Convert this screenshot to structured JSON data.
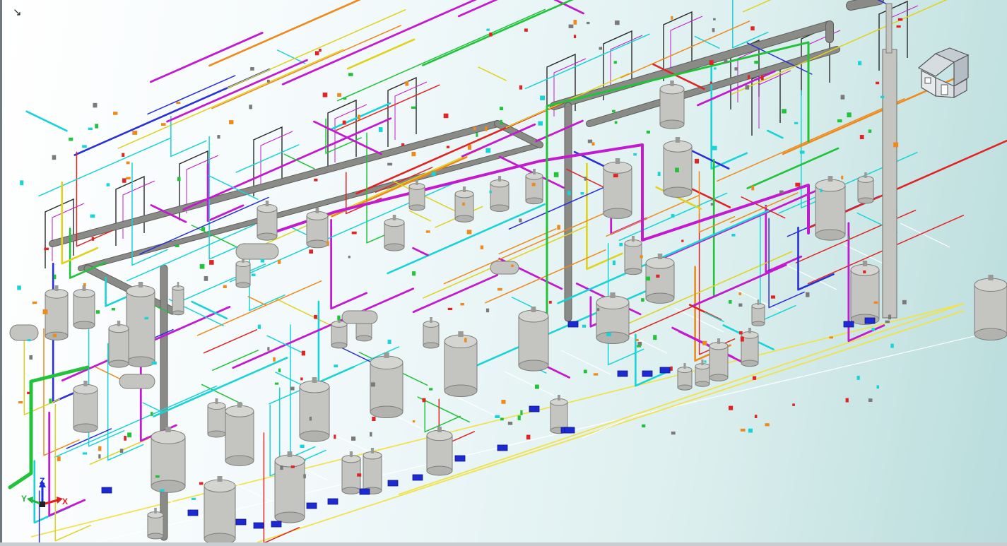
{
  "viewport": {
    "corner_glyph": "↘",
    "view_cube_icon": "house-view-cube-icon"
  },
  "axis_triad": {
    "x_label": "X",
    "y_label": "Y",
    "z_label": "Z"
  },
  "colors": {
    "background_light": "#ffffff",
    "background_teal": "#b9dcdc",
    "vessel_fill": "#c4c4c0",
    "vessel_stroke": "#7e7e7a",
    "structure_gray": "#8a8a86",
    "pipe_cyan": "#19d3d6",
    "pipe_magenta": "#c21bcf",
    "pipe_blue": "#2a2fd6",
    "pipe_red": "#e02424",
    "pipe_green": "#22c23a",
    "pipe_orange": "#ee8a1c",
    "pipe_yellow": "#e0d21a",
    "pump_blue": "#1d2ad4",
    "grid_yellow": "#f2e24a"
  }
}
